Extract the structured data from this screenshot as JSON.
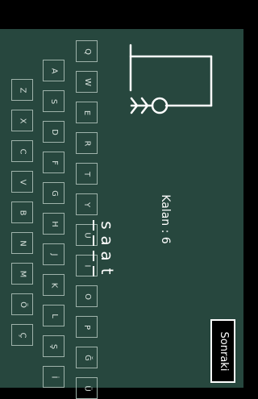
{
  "keyboard": {
    "rows": [
      [
        "Q",
        "W",
        "E",
        "R",
        "T",
        "Y",
        "U",
        "I",
        "O",
        "P",
        "Ğ",
        "Ü"
      ],
      [
        "A",
        "S",
        "D",
        "F",
        "G",
        "H",
        "J",
        "K",
        "L",
        "Ş",
        "İ"
      ],
      [
        "Z",
        "X",
        "C",
        "V",
        "B",
        "N",
        "M",
        "Ö",
        "Ç"
      ]
    ]
  },
  "game": {
    "remaining_label": "Kalan : 6",
    "word_letters": [
      "s",
      "a",
      "a",
      "t"
    ]
  },
  "buttons": {
    "next_label": "Sonraki"
  },
  "colors": {
    "board": "#27473e",
    "chalk": "#ffffff"
  }
}
